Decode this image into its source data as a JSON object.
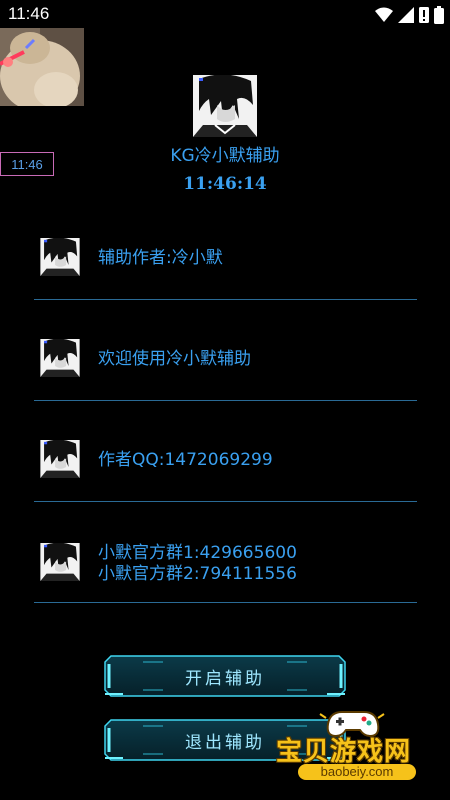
{
  "status_bar": {
    "time": "11:46",
    "icons": [
      "wifi-icon",
      "signal-icon",
      "notification-icon",
      "battery-icon"
    ]
  },
  "overlay": {
    "clock": "11:46"
  },
  "header": {
    "title": "KG冷小默辅助",
    "clock": "11:46:14"
  },
  "info_items": [
    {
      "lines": [
        "辅助作者:冷小默"
      ]
    },
    {
      "lines": [
        "欢迎使用冷小默辅助"
      ]
    },
    {
      "lines": [
        "作者QQ:1472069299"
      ]
    },
    {
      "lines": [
        "小默官方群1:429665600",
        "小默官方群2:794111556"
      ]
    }
  ],
  "buttons": {
    "start_label": "开启辅助",
    "exit_label": "退出辅助"
  },
  "watermark": {
    "text": "宝贝游戏网",
    "url": "baobeiy.com"
  },
  "colors": {
    "accent_blue": "#3aa0f0",
    "divider": "#2a6a95",
    "button_glow": "#5ee8ff",
    "watermark_gold": "#f6c21a"
  }
}
